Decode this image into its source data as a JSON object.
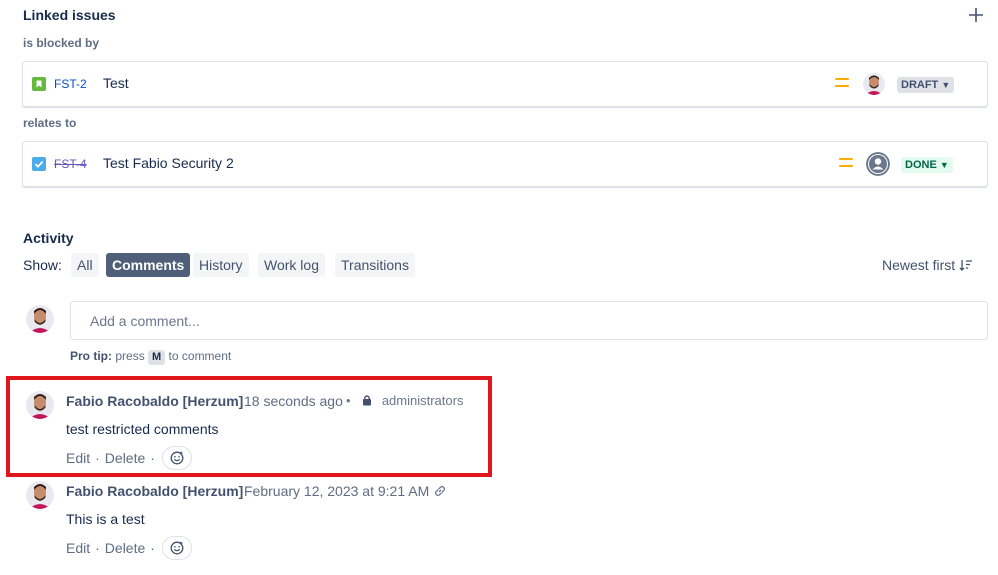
{
  "linked_issues": {
    "title": "Linked issues",
    "groups": [
      {
        "relation": "is blocked by",
        "issue": {
          "key": "FST-2",
          "summary": "Test",
          "status": "DRAFT",
          "type": "story",
          "priority": "medium"
        }
      },
      {
        "relation": "relates to",
        "issue": {
          "key": "FST-4",
          "summary": "Test Fabio Security 2",
          "status": "DONE",
          "type": "task",
          "priority": "medium"
        }
      }
    ]
  },
  "activity": {
    "title": "Activity",
    "show_label": "Show:",
    "filters": [
      "All",
      "Comments",
      "History",
      "Work log",
      "Transitions"
    ],
    "active_filter": "Comments",
    "sort_label": "Newest first"
  },
  "composer": {
    "placeholder": "Add a comment...",
    "pro_tip_bold": "Pro tip:",
    "pro_tip_press": "press",
    "pro_tip_key": "M",
    "pro_tip_rest": "to comment"
  },
  "comments": [
    {
      "author": "Fabio Racobaldo [Herzum]",
      "time": "18 seconds ago",
      "restriction": "administrators",
      "body": "test restricted comments",
      "edit": "Edit",
      "delete": "Delete"
    },
    {
      "author": "Fabio Racobaldo [Herzum]",
      "time": "February 12, 2023 at 9:21 AM",
      "body": "This is a test",
      "edit": "Edit",
      "delete": "Delete"
    }
  ],
  "colors": {
    "highlight": "#e0161d",
    "story_green": "#63ba3c",
    "task_blue": "#4bade8",
    "priority_medium": "#ffab00"
  }
}
